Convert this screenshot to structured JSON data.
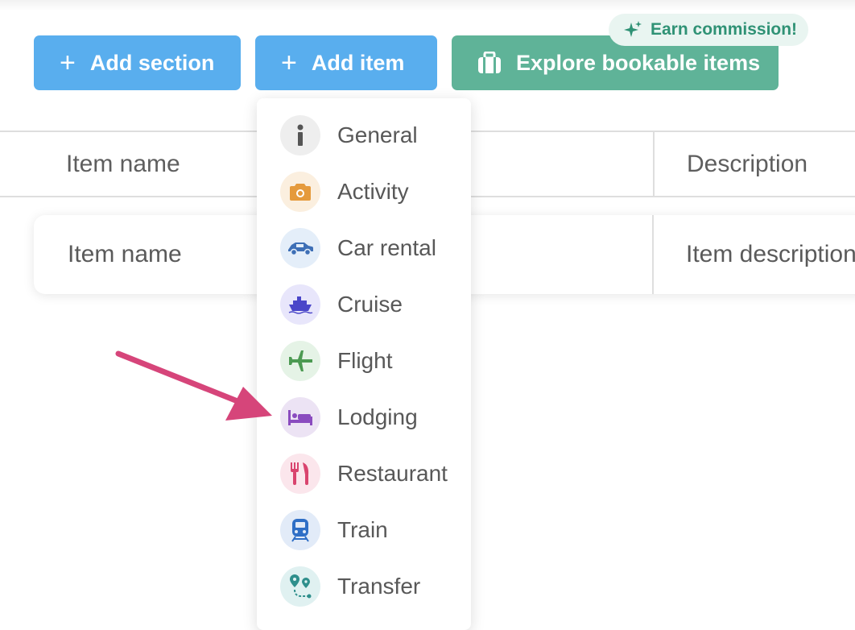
{
  "toolbar": {
    "add_section_label": "Add section",
    "add_item_label": "Add item",
    "explore_label": "Explore bookable items",
    "earn_badge_label": "Earn commission!"
  },
  "table": {
    "columns": [
      "Item name",
      "Description"
    ],
    "rows": [
      {
        "name": "Item name",
        "description": "Item description"
      }
    ]
  },
  "add_item_menu": {
    "items": [
      {
        "label": "General",
        "icon": "info-icon"
      },
      {
        "label": "Activity",
        "icon": "camera-icon"
      },
      {
        "label": "Car rental",
        "icon": "car-icon"
      },
      {
        "label": "Cruise",
        "icon": "ship-icon"
      },
      {
        "label": "Flight",
        "icon": "airplane-icon"
      },
      {
        "label": "Lodging",
        "icon": "bed-icon"
      },
      {
        "label": "Restaurant",
        "icon": "utensils-icon"
      },
      {
        "label": "Train",
        "icon": "train-icon"
      },
      {
        "label": "Transfer",
        "icon": "route-icon"
      }
    ]
  },
  "colors": {
    "primary_blue": "#59aeee",
    "explore_green": "#5fb398",
    "annotation_arrow": "#d6457a"
  }
}
